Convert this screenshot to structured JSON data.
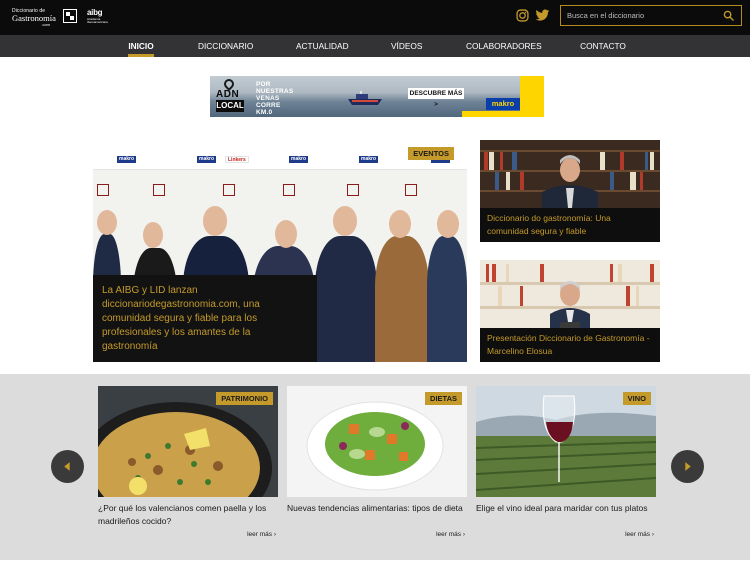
{
  "header": {
    "logo_line1": "Diccionario de",
    "logo_line2": "Gastronomía",
    "logo_line3": ".com",
    "aibg_logo": "aibg",
    "aibg_sub": "Academia Iberoamericana",
    "search_placeholder": "Busca en el diccionario",
    "icons": [
      "instagram-icon",
      "twitter-icon",
      "search-icon"
    ]
  },
  "nav": {
    "items": [
      {
        "label": "INICIO",
        "active": true
      },
      {
        "label": "DICCIONARIO",
        "active": false
      },
      {
        "label": "ACTUALIDAD",
        "active": false
      },
      {
        "label": "VÍDEOS",
        "active": false
      },
      {
        "label": "COLABORADORES",
        "active": false
      },
      {
        "label": "CONTACTO",
        "active": false
      }
    ]
  },
  "banner": {
    "adn": "ADN",
    "local": "LOCAL",
    "tagline": "POR NUESTRAS VENAS CORRE KM.0",
    "cta": "DESCUBRE MÁS >",
    "brand": "makro"
  },
  "hero": {
    "tag": "EVENTOS",
    "title": "La AIBG y LID lanzan diccionariodegastronomia.com, una comunidad segura y fiable para los profesionales y los amantes de la gastronomía",
    "wall_brands": [
      "makro",
      "makro",
      "makro",
      "makro",
      "Linkers",
      "makro"
    ]
  },
  "side_cards": [
    {
      "title": "Diccionario do gastronomía: Una comunidad segura y fiable"
    },
    {
      "title": "Presentación Diccionario de Gastronomía - Marcelino Elosua"
    }
  ],
  "carousel": {
    "cards": [
      {
        "tag": "PATRIMONIO",
        "title": "¿Por qué los valencianos comen paella y los madrileños cocido?",
        "more": "leer más ›"
      },
      {
        "tag": "DIETAS",
        "title": "Nuevas tendencias alimentarias: tipos de dieta",
        "more": "leer más ›"
      },
      {
        "tag": "VINO",
        "title": "Elige el vino ideal para maridar con tus platos",
        "more": "leer más ›"
      }
    ],
    "prev_icon": "arrow-left-icon",
    "next_icon": "arrow-right-icon"
  },
  "colors": {
    "accent_gold": "#c49a2a",
    "topbar": "#0b0b0b",
    "nav": "#333335",
    "band": "#dcdcdc"
  }
}
